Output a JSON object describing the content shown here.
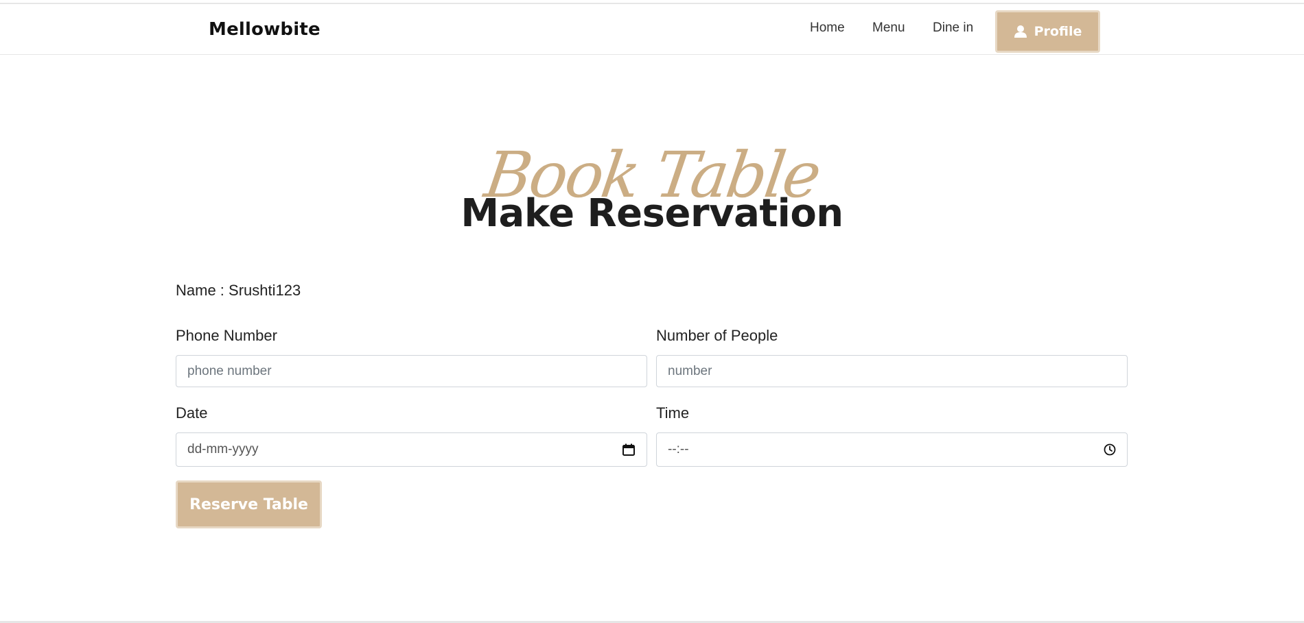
{
  "header": {
    "brand": "Mellowbite",
    "nav": [
      {
        "label": "Home"
      },
      {
        "label": "Menu"
      },
      {
        "label": "Dine in"
      }
    ],
    "profile_button": {
      "label": "Profile",
      "icon": "user-icon"
    }
  },
  "hero": {
    "script_title": "Book Table",
    "title": "Make Reservation"
  },
  "form": {
    "name_line": "Name : Srushti123",
    "phone": {
      "label": "Phone Number",
      "placeholder": "phone number"
    },
    "people": {
      "label": "Number of People",
      "placeholder": "number"
    },
    "date": {
      "label": "Date",
      "placeholder": "dd-mm-yyyy",
      "icon": "calendar-icon"
    },
    "time": {
      "label": "Time",
      "placeholder": "--:--",
      "icon": "clock-icon"
    },
    "submit_label": "Reserve Table"
  },
  "colors": {
    "accent": "#d3b896",
    "script": "#c9a97e",
    "text": "#212529"
  }
}
